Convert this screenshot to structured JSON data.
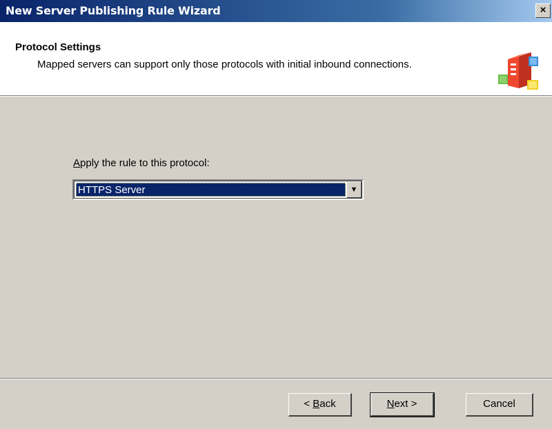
{
  "window": {
    "title": "New Server Publishing Rule Wizard",
    "close_label": "×"
  },
  "header": {
    "title": "Protocol Settings",
    "subtitle": "Mapped servers can support only those protocols with initial inbound connections.",
    "icon": "server-publishing-icon"
  },
  "form": {
    "protocol_label_accesskey": "A",
    "protocol_label_rest": "pply the rule to this protocol:",
    "protocol_value": "HTTPS Server",
    "dropdown_icon": "chevron-down-icon"
  },
  "buttons": {
    "back_prefix": "< ",
    "back_accesskey": "B",
    "back_rest": "ack",
    "next_accesskey": "N",
    "next_rest": "ext >",
    "cancel": "Cancel"
  },
  "colors": {
    "titlebar_start": "#0a246a",
    "titlebar_end": "#a6caf0",
    "selection": "#0a246a",
    "dialog_bg": "#d4d0c8"
  }
}
